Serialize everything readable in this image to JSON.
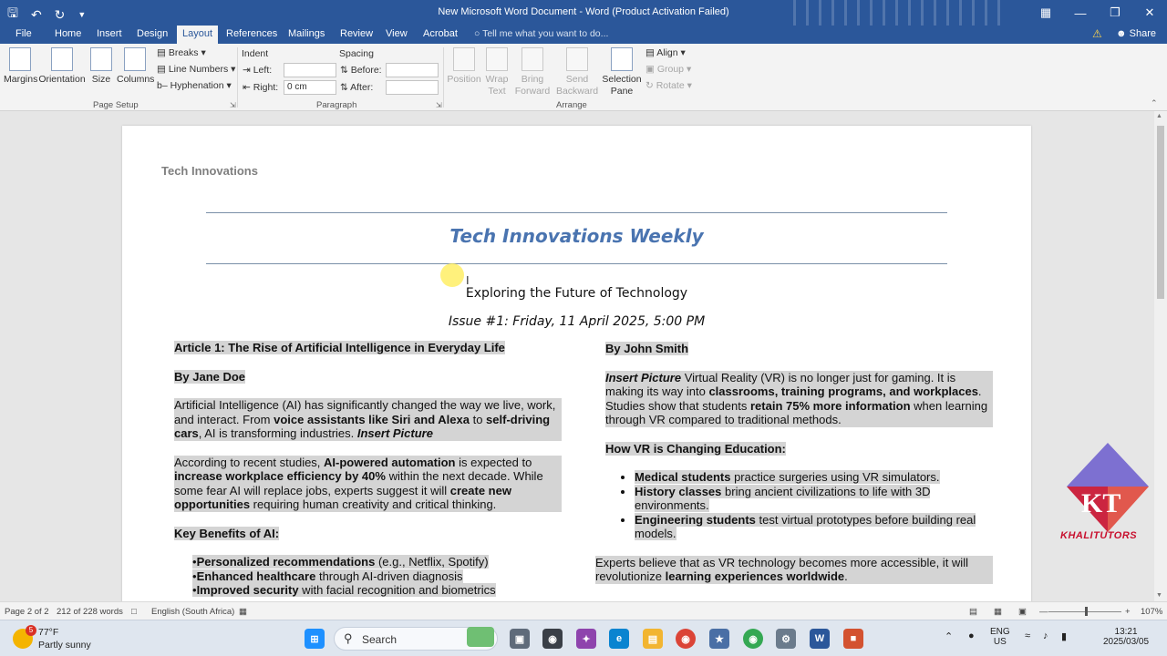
{
  "window": {
    "title": "New Microsoft Word Document - Word (Product Activation Failed)"
  },
  "tabs": [
    "File",
    "Home",
    "Insert",
    "Design",
    "Layout",
    "References",
    "Mailings",
    "Review",
    "View",
    "Acrobat"
  ],
  "active_tab": "Layout",
  "tell_me": "Tell me what you want to do...",
  "share": "Share",
  "ribbon": {
    "page_setup": {
      "margins": "Margins",
      "orientation": "Orientation",
      "size": "Size",
      "columns": "Columns",
      "breaks": "Breaks",
      "line_numbers": "Line Numbers",
      "hyphenation": "Hyphenation",
      "label": "Page Setup"
    },
    "paragraph": {
      "indent": "Indent",
      "left": "Left:",
      "left_value": "",
      "right": "Right:",
      "right_value": "0 cm",
      "spacing": "Spacing",
      "before": "Before:",
      "before_value": "",
      "after": "After:",
      "after_value": "",
      "label": "Paragraph"
    },
    "arrange": {
      "position": "Position",
      "wrap_text_1": "Wrap",
      "wrap_text_2": "Text",
      "bring_forward_1": "Bring",
      "bring_forward_2": "Forward",
      "send_backward_1": "Send",
      "send_backward_2": "Backward",
      "selection_pane_1": "Selection",
      "selection_pane_2": "Pane",
      "align": "Align",
      "group": "Group",
      "rotate": "Rotate",
      "label": "Arrange"
    }
  },
  "document": {
    "header": "Tech Innovations",
    "title": "Tech Innovations Weekly",
    "subtitle": "Exploring the Future of Technology",
    "issue": "Issue #1: Friday, 11 April 2025, 5:00 PM",
    "left": {
      "article_title": "Article 1: The Rise of Artificial Intelligence in Everyday Life",
      "author": "By Jane Doe",
      "p1": {
        "a": "Artificial Intelligence (AI) has significantly changed the way we live, work, and interact. From ",
        "b": "voice assistants like Siri and Alexa",
        "c": " to ",
        "d": "self-driving cars",
        "e": ", AI is transforming industries. ",
        "f": "Insert Picture"
      },
      "p2": {
        "a": "According to recent studies, ",
        "b": "AI-powered automation",
        "c": " is expected to ",
        "d": "increase workplace efficiency by 40%",
        "e": " within the next decade. While some fear AI will replace jobs, experts suggest it will ",
        "f": "create new opportunities",
        "g": " requiring human creativity and critical thinking."
      },
      "benefits_title": "Key Benefits of AI:",
      "benefits": [
        {
          "bold": "Personalized recommendations",
          "rest": " (e.g., Netflix, Spotify)"
        },
        {
          "bold": "Enhanced healthcare",
          "rest": " through AI-driven diagnosis"
        },
        {
          "bold": "Improved security",
          "rest": " with facial recognition and biometrics"
        }
      ]
    },
    "right": {
      "author": "By John Smith",
      "p1": {
        "a": "Insert Picture",
        "b": " Virtual Reality (VR) is no longer just for gaming. It is making its way into ",
        "c": "classrooms, training programs, and workplaces",
        "d": ". Studies show that students ",
        "e": "retain 75% more information",
        "f": " when learning through VR compared to traditional methods."
      },
      "section_title": "How VR is Changing Education:",
      "items": [
        {
          "bold": "Medical students",
          "rest": " practice surgeries using VR simulators."
        },
        {
          "bold": "History classes",
          "rest": " bring ancient civilizations to life with 3D environments."
        },
        {
          "bold": "Engineering students",
          "rest": " test virtual prototypes before building real models."
        }
      ],
      "p2": {
        "a": "Experts believe that as VR technology becomes more accessible, it will revolutionize ",
        "b": "learning experiences worldwide",
        "c": "."
      }
    }
  },
  "statusbar": {
    "page": "Page 2 of 2",
    "words": "212 of 228 words",
    "language": "English (South Africa)",
    "zoom": "107%"
  },
  "taskbar": {
    "weather_temp": "77°F",
    "weather_desc": "Partly sunny",
    "weather_badge": "5",
    "search": "Search",
    "lang_1": "ENG",
    "lang_2": "US",
    "time": "13:21",
    "date": "2025/03/05"
  },
  "logo": {
    "letters": "KT",
    "name": "KHALITUTORS"
  },
  "colors": {
    "word_blue": "#2b579a",
    "title_blue": "#4a74b0",
    "selection_gray": "#d4d4d4"
  }
}
